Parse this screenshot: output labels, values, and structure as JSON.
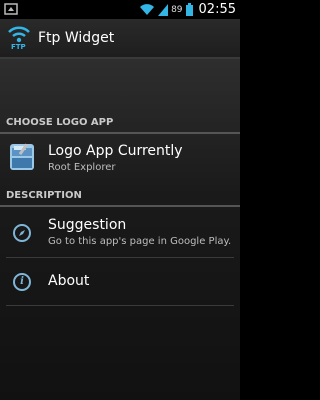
{
  "status_bar": {
    "battery_level": "89",
    "time": "02:55",
    "icons": [
      "android-debug-icon",
      "wifi-icon",
      "signal-icon",
      "battery-icon"
    ]
  },
  "action_bar": {
    "app_icon_label": "FTP",
    "title": "Ftp Widget"
  },
  "sections": {
    "logo": {
      "header": "CHOOSE LOGO APP"
    },
    "description": {
      "header": "DESCRIPTION"
    }
  },
  "items": {
    "logo_app": {
      "title": "Logo App Currently",
      "subtitle": "Root Explorer",
      "icon": "root-explorer-icon"
    },
    "suggestion": {
      "title": "Suggestion",
      "subtitle": "Go to this app's page in Google Play.",
      "icon": "compass-icon"
    },
    "about": {
      "title": "About",
      "icon": "info-icon"
    }
  },
  "colors": {
    "accent_blue": "#33b5e5",
    "icon_blue": "#7fb6d8",
    "header_text": "#c9c9c9"
  }
}
